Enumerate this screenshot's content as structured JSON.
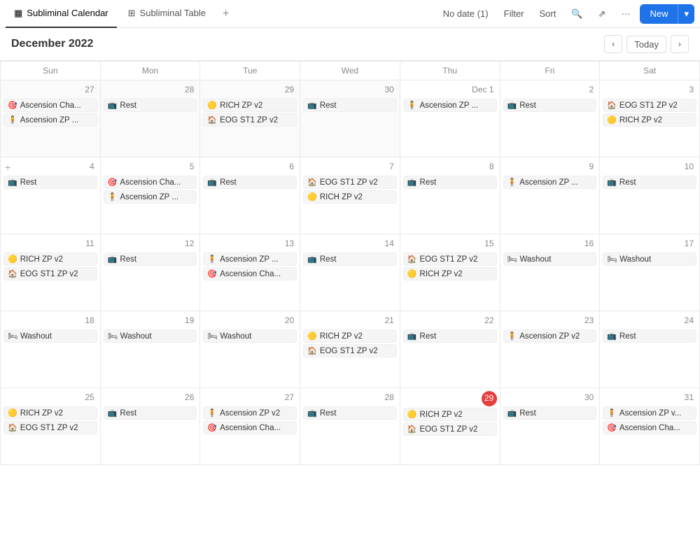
{
  "app": {
    "title": "Subliminal Calendar",
    "tab2": "Subliminal Table"
  },
  "nav": {
    "no_date": "No date (1)",
    "filter": "Filter",
    "sort": "Sort",
    "more": "···",
    "new_btn": "New"
  },
  "calendar": {
    "title": "December 2022",
    "today_btn": "Today",
    "days": [
      "Sun",
      "Mon",
      "Tue",
      "Wed",
      "Thu",
      "Fri",
      "Sat"
    ]
  },
  "weeks": [
    [
      {
        "num": "27",
        "other": true,
        "events": [
          {
            "icon": "target",
            "label": "Ascension Cha..."
          },
          {
            "icon": "person",
            "label": "Ascension ZP ..."
          }
        ]
      },
      {
        "num": "28",
        "other": true,
        "events": [
          {
            "icon": "tv",
            "label": "Rest"
          }
        ]
      },
      {
        "num": "29",
        "other": true,
        "events": [
          {
            "icon": "yellow",
            "label": "RICH ZP v2"
          },
          {
            "icon": "house",
            "label": "EOG ST1 ZP v2"
          }
        ]
      },
      {
        "num": "30",
        "other": true,
        "events": [
          {
            "icon": "tv",
            "label": "Rest"
          }
        ]
      },
      {
        "num": "Dec 1",
        "other": false,
        "events": [
          {
            "icon": "person",
            "label": "Ascension ZP ..."
          }
        ]
      },
      {
        "num": "2",
        "other": false,
        "events": [
          {
            "icon": "tv",
            "label": "Rest"
          }
        ]
      },
      {
        "num": "3",
        "other": false,
        "events": [
          {
            "icon": "house",
            "label": "EOG ST1 ZP v2"
          },
          {
            "icon": "yellow",
            "label": "RICH ZP v2"
          }
        ]
      }
    ],
    [
      {
        "num": "4",
        "other": false,
        "addBtn": true,
        "events": [
          {
            "icon": "tv",
            "label": "Rest"
          }
        ]
      },
      {
        "num": "5",
        "other": false,
        "events": [
          {
            "icon": "target",
            "label": "Ascension Cha..."
          },
          {
            "icon": "person",
            "label": "Ascension ZP ..."
          }
        ]
      },
      {
        "num": "6",
        "other": false,
        "events": [
          {
            "icon": "tv",
            "label": "Rest"
          }
        ]
      },
      {
        "num": "7",
        "other": false,
        "events": [
          {
            "icon": "house",
            "label": "EOG ST1 ZP v2"
          },
          {
            "icon": "yellow",
            "label": "RICH ZP v2"
          }
        ]
      },
      {
        "num": "8",
        "other": false,
        "events": [
          {
            "icon": "tv",
            "label": "Rest"
          }
        ]
      },
      {
        "num": "9",
        "other": false,
        "events": [
          {
            "icon": "person",
            "label": "Ascension ZP ..."
          }
        ]
      },
      {
        "num": "10",
        "other": false,
        "events": [
          {
            "icon": "tv",
            "label": "Rest"
          }
        ]
      }
    ],
    [
      {
        "num": "11",
        "other": false,
        "events": [
          {
            "icon": "yellow",
            "label": "RICH ZP v2"
          },
          {
            "icon": "house",
            "label": "EOG ST1 ZP v2"
          }
        ]
      },
      {
        "num": "12",
        "other": false,
        "events": [
          {
            "icon": "tv",
            "label": "Rest"
          }
        ]
      },
      {
        "num": "13",
        "other": false,
        "events": [
          {
            "icon": "person",
            "label": "Ascension ZP ..."
          },
          {
            "icon": "target",
            "label": "Ascension Cha..."
          }
        ]
      },
      {
        "num": "14",
        "other": false,
        "events": [
          {
            "icon": "tv",
            "label": "Rest"
          }
        ]
      },
      {
        "num": "15",
        "other": false,
        "events": [
          {
            "icon": "house",
            "label": "EOG ST1 ZP v2"
          },
          {
            "icon": "yellow",
            "label": "RICH ZP v2"
          }
        ]
      },
      {
        "num": "16",
        "other": false,
        "events": [
          {
            "icon": "bed",
            "label": "Washout"
          }
        ]
      },
      {
        "num": "17",
        "other": false,
        "events": [
          {
            "icon": "bed",
            "label": "Washout"
          }
        ]
      }
    ],
    [
      {
        "num": "18",
        "other": false,
        "events": [
          {
            "icon": "bed",
            "label": "Washout"
          }
        ]
      },
      {
        "num": "19",
        "other": false,
        "events": [
          {
            "icon": "bed",
            "label": "Washout"
          }
        ]
      },
      {
        "num": "20",
        "other": false,
        "events": [
          {
            "icon": "bed",
            "label": "Washout"
          }
        ]
      },
      {
        "num": "21",
        "other": false,
        "events": [
          {
            "icon": "yellow",
            "label": "RICH ZP v2"
          },
          {
            "icon": "house",
            "label": "EOG ST1 ZP v2"
          }
        ]
      },
      {
        "num": "22",
        "other": false,
        "events": [
          {
            "icon": "tv",
            "label": "Rest"
          }
        ]
      },
      {
        "num": "23",
        "other": false,
        "events": [
          {
            "icon": "person",
            "label": "Ascension ZP v2"
          }
        ]
      },
      {
        "num": "24",
        "other": false,
        "events": [
          {
            "icon": "tv",
            "label": "Rest"
          }
        ]
      }
    ],
    [
      {
        "num": "25",
        "other": false,
        "events": [
          {
            "icon": "yellow",
            "label": "RICH ZP v2"
          },
          {
            "icon": "house",
            "label": "EOG ST1 ZP v2"
          }
        ]
      },
      {
        "num": "26",
        "other": false,
        "events": [
          {
            "icon": "tv",
            "label": "Rest"
          }
        ]
      },
      {
        "num": "27",
        "other": false,
        "events": [
          {
            "icon": "person",
            "label": "Ascension ZP v2"
          },
          {
            "icon": "target",
            "label": "Ascension Cha..."
          }
        ]
      },
      {
        "num": "28",
        "other": false,
        "events": [
          {
            "icon": "tv",
            "label": "Rest"
          }
        ]
      },
      {
        "num": "29",
        "other": false,
        "today": true,
        "events": [
          {
            "icon": "yellow",
            "label": "RICH ZP v2"
          },
          {
            "icon": "house",
            "label": "EOG ST1 ZP v2"
          }
        ]
      },
      {
        "num": "30",
        "other": false,
        "events": [
          {
            "icon": "tv",
            "label": "Rest"
          }
        ]
      },
      {
        "num": "31",
        "other": false,
        "events": [
          {
            "icon": "person",
            "label": "Ascension ZP v..."
          },
          {
            "icon": "target",
            "label": "Ascension Cha..."
          }
        ]
      }
    ]
  ]
}
